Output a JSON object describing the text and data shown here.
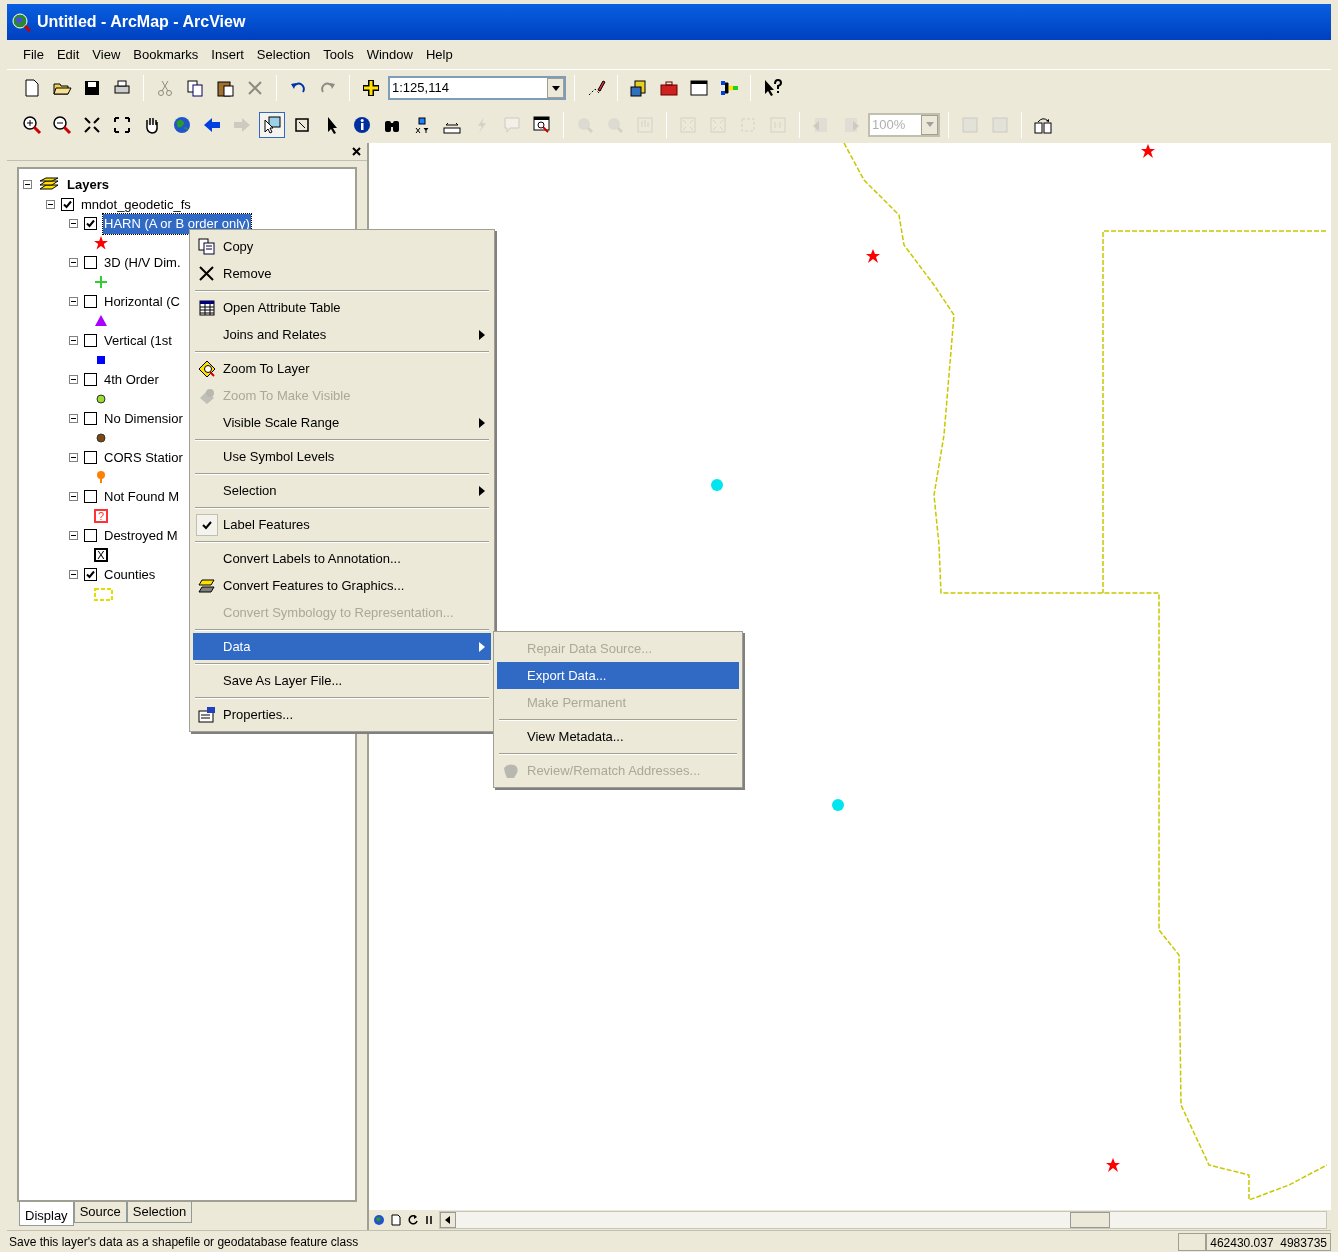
{
  "window": {
    "title": "Untitled - ArcMap - ArcView"
  },
  "menu_bar": [
    "File",
    "Edit",
    "View",
    "Bookmarks",
    "Insert",
    "Selection",
    "Tools",
    "Window",
    "Help"
  ],
  "toolbars": [
    [
      {
        "kind": "button",
        "disabled": false
      },
      {
        "kind": "button",
        "disabled": false
      },
      {
        "kind": "button",
        "disabled": false
      },
      {
        "kind": "button",
        "disabled": false
      },
      {
        "kind": "separator"
      },
      {
        "kind": "button",
        "disabled": true
      },
      {
        "kind": "button",
        "disabled": false
      },
      {
        "kind": "button",
        "disabled": false
      },
      {
        "kind": "button",
        "disabled": true
      },
      {
        "kind": "separator"
      },
      {
        "kind": "button",
        "disabled": false
      },
      {
        "kind": "button",
        "disabled": true
      },
      {
        "kind": "separator"
      },
      {
        "kind": "button",
        "disabled": false
      },
      {
        "kind": "combo",
        "value": "1:125,114",
        "disabled": false
      },
      {
        "kind": "separator"
      },
      {
        "kind": "button",
        "disabled": false
      },
      {
        "kind": "separator"
      },
      {
        "kind": "button",
        "disabled": false
      },
      {
        "kind": "button",
        "disabled": false
      },
      {
        "kind": "button",
        "disabled": false
      },
      {
        "kind": "button",
        "disabled": false
      },
      {
        "kind": "separator"
      },
      {
        "kind": "button",
        "disabled": false
      }
    ],
    [
      {
        "kind": "button",
        "disabled": false
      },
      {
        "kind": "button",
        "disabled": false
      },
      {
        "kind": "button",
        "disabled": false
      },
      {
        "kind": "button",
        "disabled": false
      },
      {
        "kind": "button",
        "disabled": false
      },
      {
        "kind": "button",
        "disabled": false
      },
      {
        "kind": "button",
        "disabled": false
      },
      {
        "kind": "button",
        "disabled": true
      },
      {
        "kind": "button",
        "disabled": false,
        "pressed": true
      },
      {
        "kind": "button",
        "disabled": false
      },
      {
        "kind": "button",
        "disabled": false
      },
      {
        "kind": "button",
        "disabled": false
      },
      {
        "kind": "button",
        "disabled": false
      },
      {
        "kind": "button",
        "disabled": false
      },
      {
        "kind": "button",
        "disabled": false
      },
      {
        "kind": "button",
        "disabled": true
      },
      {
        "kind": "button",
        "disabled": true
      },
      {
        "kind": "button",
        "disabled": false
      },
      {
        "kind": "separator"
      },
      {
        "kind": "button",
        "disabled": true
      },
      {
        "kind": "button",
        "disabled": true
      },
      {
        "kind": "button",
        "disabled": true
      },
      {
        "kind": "separator"
      },
      {
        "kind": "button",
        "disabled": true
      },
      {
        "kind": "button",
        "disabled": true
      },
      {
        "kind": "button",
        "disabled": true
      },
      {
        "kind": "button",
        "disabled": true
      },
      {
        "kind": "separator"
      },
      {
        "kind": "button",
        "disabled": true
      },
      {
        "kind": "button",
        "disabled": true
      },
      {
        "kind": "combo",
        "value": "100%",
        "disabled": true
      },
      {
        "kind": "separator"
      },
      {
        "kind": "button",
        "disabled": true
      },
      {
        "kind": "button",
        "disabled": true
      },
      {
        "kind": "separator"
      },
      {
        "kind": "button",
        "disabled": false
      }
    ]
  ],
  "toc": {
    "tree": {
      "label": "Layers",
      "expanded": true,
      "children": [
        {
          "label": "mndot_geodetic_fs",
          "expanded": true,
          "checked": true,
          "children": [
            {
              "label": "HARN (A or B order only)",
              "expanded": true,
              "checked": true,
              "selected": true,
              "symbol": {
                "kind": "star",
                "color": "#ff0000"
              }
            },
            {
              "label": "3D (H/V Dim.",
              "expanded": true,
              "checked": false,
              "selected": false,
              "symbol": {
                "kind": "cross",
                "color": "#33cc33"
              }
            },
            {
              "label": "Horizontal (C",
              "expanded": true,
              "checked": false,
              "selected": false,
              "symbol": {
                "kind": "triangle",
                "color": "#aa00ff"
              }
            },
            {
              "label": "Vertical (1st",
              "expanded": true,
              "checked": false,
              "selected": false,
              "symbol": {
                "kind": "square",
                "color": "#0000ff"
              }
            },
            {
              "label": "4th Order",
              "expanded": true,
              "checked": false,
              "selected": false,
              "symbol": {
                "kind": "circle",
                "color": "#99dd33"
              }
            },
            {
              "label": "No Dimensior",
              "expanded": true,
              "checked": false,
              "selected": false,
              "symbol": {
                "kind": "circle",
                "color": "#7a4a10"
              }
            },
            {
              "label": "CORS Statior",
              "expanded": true,
              "checked": false,
              "selected": false,
              "symbol": {
                "kind": "pin",
                "color": "#ff7f00"
              }
            },
            {
              "label": "Not Found M",
              "expanded": true,
              "checked": false,
              "selected": false,
              "symbol": {
                "kind": "box-mark",
                "color": "#ff3333",
                "mark": "?"
              }
            },
            {
              "label": "Destroyed M",
              "expanded": true,
              "checked": false,
              "selected": false,
              "symbol": {
                "kind": "box-mark",
                "color": "#000000",
                "mark": "X"
              }
            },
            {
              "label": "Counties",
              "expanded": true,
              "checked": true,
              "selected": false,
              "symbol": {
                "kind": "dashed-rect",
                "color": "#e0e000"
              }
            }
          ]
        }
      ]
    }
  },
  "toc_tabs": [
    {
      "label": "Display",
      "selected": true
    },
    {
      "label": "Source",
      "selected": false
    },
    {
      "label": "Selection",
      "selected": false
    }
  ],
  "context_menu": {
    "groups": [
      [
        {
          "label": "Copy",
          "disabled": false,
          "submenu": false,
          "checked": false,
          "selected": false
        },
        {
          "label": "Remove",
          "disabled": false,
          "submenu": false,
          "checked": false,
          "selected": false
        }
      ],
      [
        {
          "label": "Open Attribute Table",
          "disabled": false,
          "submenu": false,
          "checked": false,
          "selected": false
        },
        {
          "label": "Joins and Relates",
          "disabled": false,
          "submenu": true,
          "checked": false,
          "selected": false
        }
      ],
      [
        {
          "label": "Zoom To Layer",
          "disabled": false,
          "submenu": false,
          "checked": false,
          "selected": false
        },
        {
          "label": "Zoom To Make Visible",
          "disabled": true,
          "submenu": false,
          "checked": false,
          "selected": false
        },
        {
          "label": "Visible Scale Range",
          "disabled": false,
          "submenu": true,
          "checked": false,
          "selected": false
        }
      ],
      [
        {
          "label": "Use Symbol Levels",
          "disabled": false,
          "submenu": false,
          "checked": false,
          "selected": false
        }
      ],
      [
        {
          "label": "Selection",
          "disabled": false,
          "submenu": true,
          "checked": false,
          "selected": false
        }
      ],
      [
        {
          "label": "Label Features",
          "disabled": false,
          "submenu": false,
          "checked": true,
          "selected": false
        }
      ],
      [
        {
          "label": "Convert Labels to Annotation...",
          "disabled": false,
          "submenu": false,
          "checked": false,
          "selected": false
        },
        {
          "label": "Convert Features to Graphics...",
          "disabled": false,
          "submenu": false,
          "checked": false,
          "selected": false
        },
        {
          "label": "Convert Symbology to Representation...",
          "disabled": true,
          "submenu": false,
          "checked": false,
          "selected": false
        }
      ],
      [
        {
          "label": "Data",
          "disabled": false,
          "submenu": true,
          "checked": false,
          "selected": true
        }
      ],
      [
        {
          "label": "Save As Layer File...",
          "disabled": false,
          "submenu": false,
          "checked": false,
          "selected": false
        }
      ],
      [
        {
          "label": "Properties...",
          "disabled": false,
          "submenu": false,
          "checked": false,
          "selected": false
        }
      ]
    ]
  },
  "submenu": {
    "groups": [
      [
        {
          "label": "Repair Data Source...",
          "disabled": true,
          "selected": false
        },
        {
          "label": "Export Data...",
          "disabled": false,
          "selected": true
        },
        {
          "label": "Make Permanent",
          "disabled": true,
          "selected": false
        }
      ],
      [
        {
          "label": "View Metadata...",
          "disabled": false,
          "selected": false
        }
      ],
      [
        {
          "label": "Review/Rematch Addresses...",
          "disabled": true,
          "selected": false
        }
      ]
    ]
  },
  "map": {
    "features": [
      {
        "kind": "star",
        "color": "#ff0000"
      },
      {
        "kind": "star",
        "color": "#ff0000"
      },
      {
        "kind": "star",
        "color": "#ff0000"
      },
      {
        "kind": "dot",
        "color": "#00e5ee"
      },
      {
        "kind": "dot",
        "color": "#00e5ee"
      }
    ]
  },
  "status_bar": {
    "message": "Save this layer's data as a shapefile or geodatabase feature class",
    "coordinates": "462430.037  4983735"
  }
}
